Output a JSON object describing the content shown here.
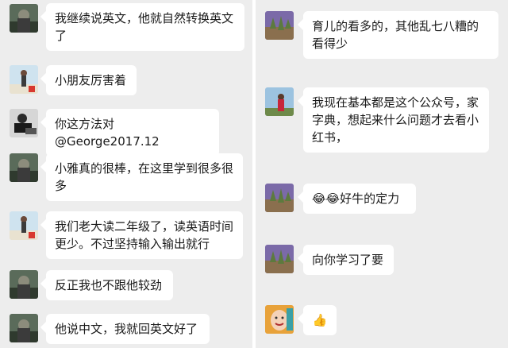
{
  "left": {
    "messages": [
      {
        "text": "我继续说英文，他就自然转换英文了",
        "avatar": "avatar-dark-outdoor-icon"
      },
      {
        "text": "小朋友厉害着",
        "avatar": "avatar-child-beach-icon"
      },
      {
        "text": "你这方法对@George2017.12",
        "avatar": "avatar-man-bw-icon"
      },
      {
        "text": "小雅真的很棒，在这里学到很多很多",
        "avatar": "avatar-dark-outdoor-icon"
      },
      {
        "text": "我们老大读二年级了，读英语时间更少。不过坚持输入输出就行",
        "avatar": "avatar-child-beach-icon"
      },
      {
        "text": "反正我也不跟他较劲",
        "avatar": "avatar-dark-outdoor-icon"
      },
      {
        "text": "他说中文，我就回英文好了",
        "avatar": "avatar-dark-outdoor-icon"
      }
    ]
  },
  "right": {
    "messages": [
      {
        "text": "育儿的看多的，其他乱七八糟的看得少",
        "avatar": "avatar-purple-plant-icon"
      },
      {
        "text": "我现在基本都是这个公众号，家字典，想起来什么问题才去看小红书，",
        "avatar": "avatar-person-sky-icon"
      },
      {
        "text": "好牛的定力",
        "emoji": "😂😂",
        "avatar": "avatar-purple-plant-icon"
      },
      {
        "text": "向你学习了要",
        "avatar": "avatar-purple-plant-icon"
      },
      {
        "text": "👍",
        "avatar": "avatar-smiling-face-icon"
      }
    ]
  },
  "colors": {
    "background": "#ededed",
    "bubble": "#ffffff",
    "text": "#1a1a1a"
  }
}
